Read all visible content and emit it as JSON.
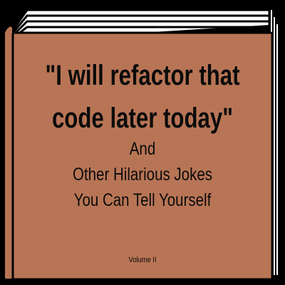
{
  "book": {
    "cover_color": "#b87556",
    "page_color": "#ffffff",
    "edge_color": "#000000",
    "title_line1": "\"I will refactor that",
    "title_line2": "code later today\"",
    "subtitle_line1": "And",
    "subtitle_line2": "Other Hilarious Jokes",
    "subtitle_line3": "You Can Tell Yourself",
    "volume": "Volume II"
  }
}
